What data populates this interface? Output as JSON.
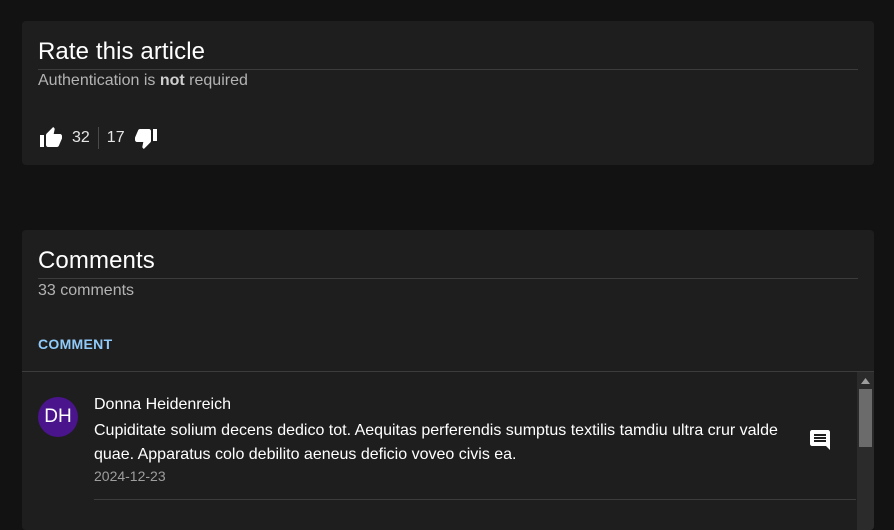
{
  "rating": {
    "title": "Rate this article",
    "subtitle_prefix": "Authentication is ",
    "subtitle_bold": "not",
    "subtitle_suffix": " required",
    "upvotes": "32",
    "downvotes": "17"
  },
  "comments": {
    "title": "Comments",
    "count_text": "33 comments",
    "action_label": "COMMENT",
    "items": [
      {
        "initials": "DH",
        "author": "Donna Heidenreich",
        "body": "Cupiditate solium decens dedico tot. Aequitas perferendis sumptus textilis tamdiu ultra crur valde quae. Apparatus colo debilito aeneus deficio voveo civis ea.",
        "date": "2024-12-23"
      }
    ]
  },
  "colors": {
    "background": "#121212",
    "card": "#1e1e1e",
    "accent": "#90caf9",
    "avatar": "#4a148c"
  },
  "icons": {
    "upvote": "thumb-up-icon",
    "downvote": "thumb-down-icon",
    "reply": "comment-icon",
    "scroll_up": "scroll-up-arrow-icon"
  }
}
